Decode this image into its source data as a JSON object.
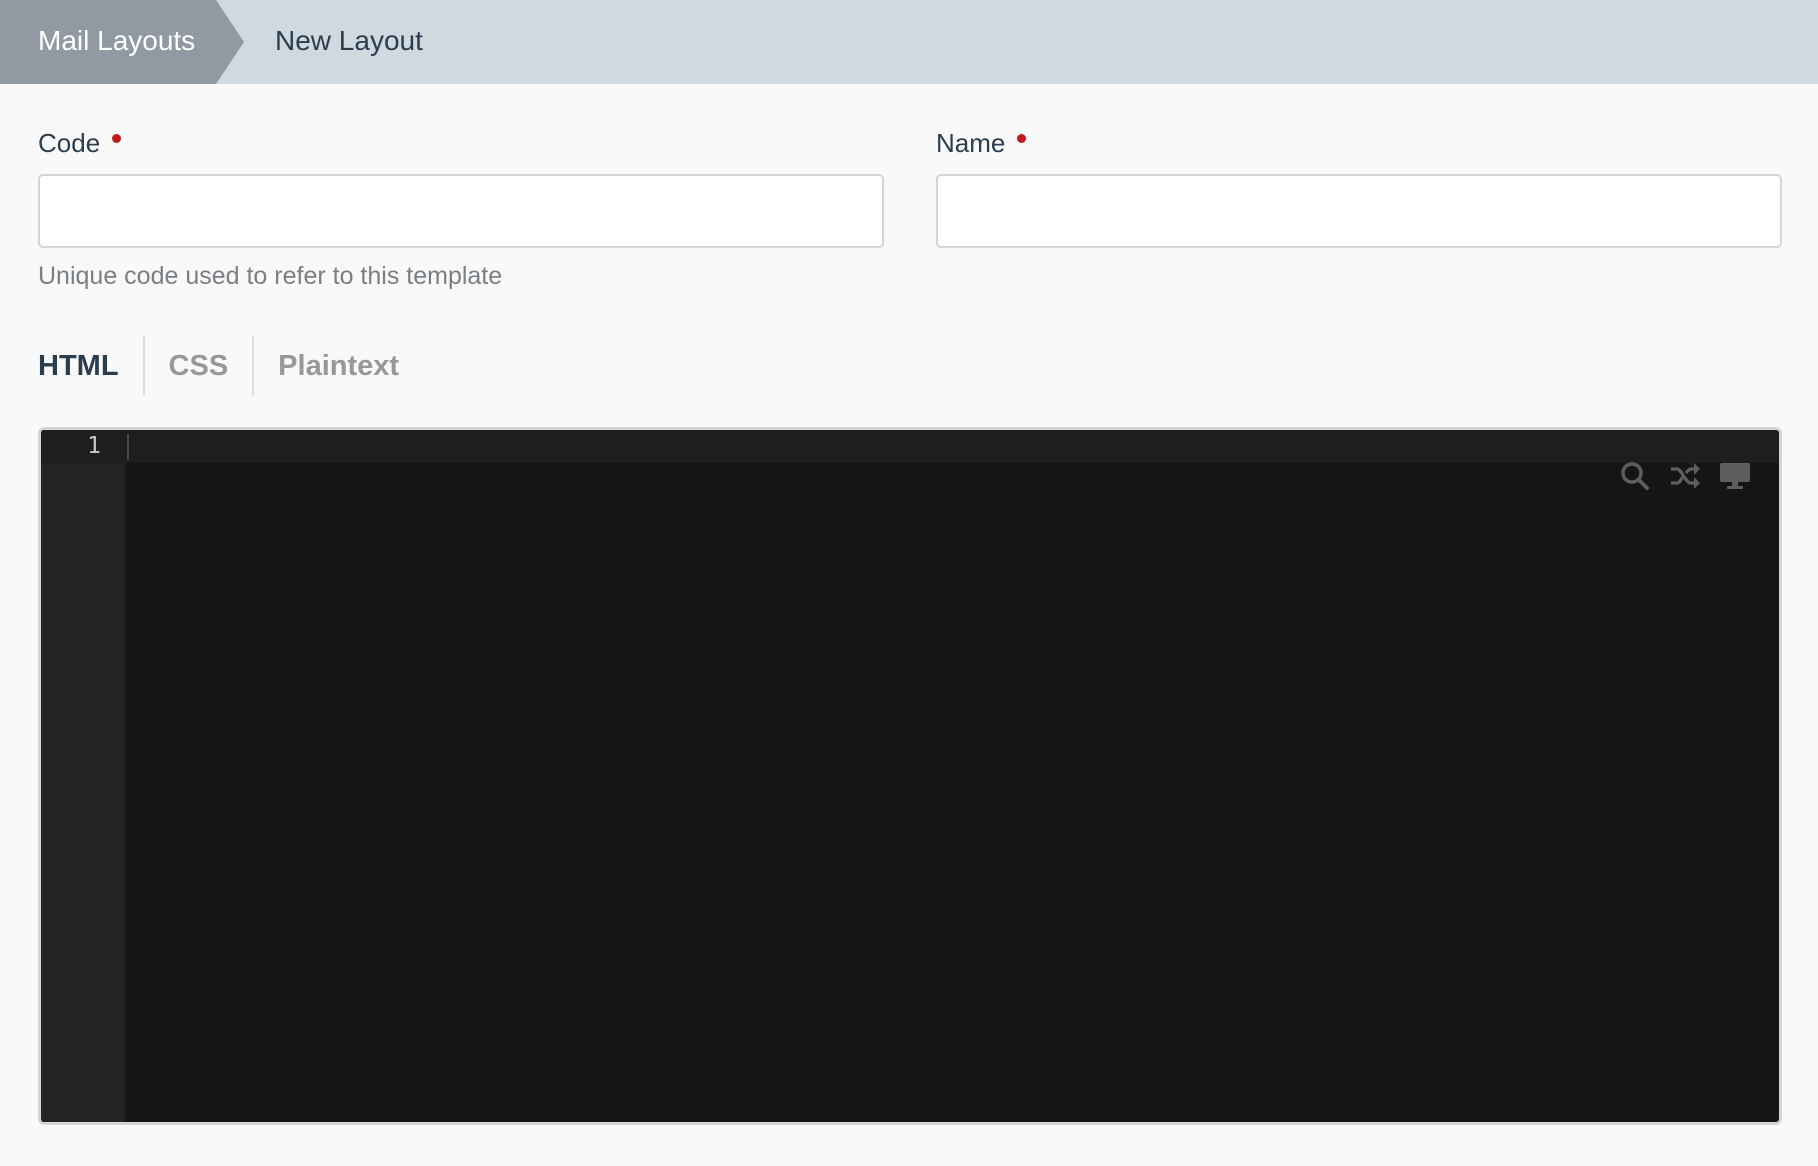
{
  "breadcrumb": {
    "parent": "Mail Layouts",
    "current": "New Layout"
  },
  "form": {
    "code_label": "Code",
    "code_value": "",
    "code_help": "Unique code used to refer to this template",
    "name_label": "Name",
    "name_value": ""
  },
  "tabs": [
    {
      "label": "HTML",
      "active": true
    },
    {
      "label": "CSS",
      "active": false
    },
    {
      "label": "Plaintext",
      "active": false
    }
  ],
  "editor": {
    "line_numbers": [
      "1"
    ],
    "tools": [
      "search-icon",
      "shuffle-icon",
      "desktop-icon"
    ]
  },
  "colors": {
    "required_dot": "#c0191d",
    "breadcrumb_bg": "#d1d9e0",
    "breadcrumb_parent_bg": "#919aa3",
    "editor_bg": "#151515"
  }
}
